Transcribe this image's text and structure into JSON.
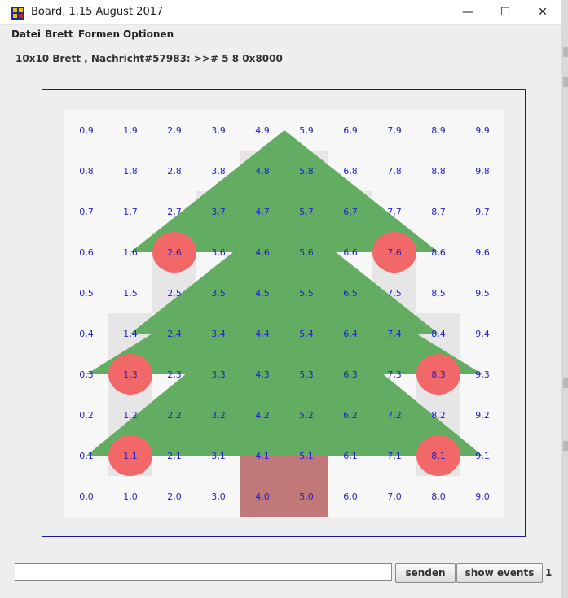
{
  "window": {
    "title": "Board, 1.15 August 2017",
    "controls": {
      "minimize": "—",
      "maximize": "☐",
      "close": "✕"
    }
  },
  "menu": {
    "items": [
      "Datei",
      "Brett",
      "Formen",
      "Optionen"
    ]
  },
  "status": {
    "text": "10x10 Brett , Nachricht#57983: >># 5 8 0x8000"
  },
  "board": {
    "cols": 10,
    "rows": 10,
    "colors": {
      "background": "#eeeeee",
      "cell_light": "#f7f7f7",
      "cell_shade": "#e6e6e6",
      "tree": "#62ad62",
      "trunk": "#c07878",
      "ornament": "#f26868",
      "label": "#1f1fd0",
      "frame": "#1a1aa8"
    },
    "shaded_cells": [
      [
        4,
        8
      ],
      [
        5,
        8
      ],
      [
        3,
        7
      ],
      [
        6,
        7
      ],
      [
        2,
        6
      ],
      [
        7,
        6
      ],
      [
        2,
        5
      ],
      [
        7,
        5
      ],
      [
        1,
        4
      ],
      [
        8,
        4
      ],
      [
        1,
        3
      ],
      [
        8,
        3
      ],
      [
        1,
        2
      ],
      [
        8,
        2
      ],
      [
        1,
        1
      ],
      [
        8,
        1
      ]
    ],
    "trunk_cells": [
      [
        4,
        1
      ],
      [
        5,
        1
      ],
      [
        4,
        0
      ],
      [
        5,
        0
      ]
    ],
    "ornament_cells": [
      [
        2,
        6
      ],
      [
        7,
        6
      ],
      [
        1,
        3
      ],
      [
        8,
        3
      ],
      [
        1,
        1
      ],
      [
        8,
        1
      ]
    ],
    "tree_tiers": [
      {
        "apex": [
          4.5,
          9.5
        ],
        "base_y": 6.5,
        "base_x": [
          1.5,
          7.5
        ]
      },
      {
        "apex": [
          4.5,
          7.5
        ],
        "base_y": 4.5,
        "base_x": [
          1.5,
          7.5
        ]
      },
      {
        "apex": [
          4.5,
          6.5
        ],
        "base_y": 3.5,
        "base_x": [
          0.5,
          8.5
        ]
      },
      {
        "apex": [
          4.5,
          5.5
        ],
        "base_y": 1.5,
        "base_x": [
          0.5,
          8.5
        ]
      }
    ]
  },
  "footer": {
    "input_value": "",
    "send_label": "senden",
    "events_label": "show events",
    "counter": "1"
  }
}
